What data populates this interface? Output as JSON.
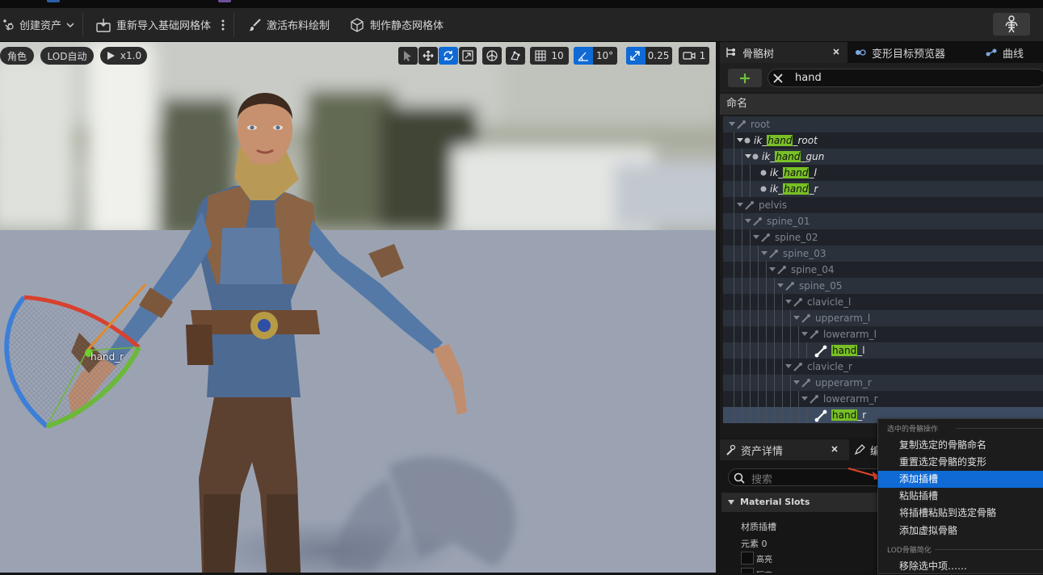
{
  "toolbar": {
    "create_asset": "创建资产",
    "reimport_base_mesh": "重新导入基础网格体",
    "activate_cloth_paint": "激活布料绘制",
    "make_static_mesh": "制作静态网格体"
  },
  "viewport": {
    "character_label": "角色",
    "lod_label": "LOD自动",
    "play_speed": "x1.0",
    "grid_size": "10",
    "rotation_snap": "10°",
    "scale_snap": "0.25",
    "camera_speed": "1",
    "bone_label": "hand_r"
  },
  "skeleton_panel": {
    "tabs": [
      {
        "label": "骨骼树",
        "icon": "bone-tree-icon"
      },
      {
        "label": "变形目标预览器",
        "icon": "morph-target-icon"
      },
      {
        "label": "曲线",
        "icon": "curve-icon"
      }
    ],
    "search_value": "hand",
    "column_header": "命名",
    "tree": [
      {
        "pre": "",
        "match": "",
        "post": "root",
        "depth": 0,
        "kind": "bone",
        "italic": false,
        "dim": true
      },
      {
        "pre": "ik_",
        "match": "hand",
        "post": "_root",
        "depth": 1,
        "kind": "virtual",
        "italic": true,
        "dim": false
      },
      {
        "pre": "ik_",
        "match": "hand",
        "post": "_gun",
        "depth": 2,
        "kind": "virtual",
        "italic": true,
        "dim": false
      },
      {
        "pre": "ik_",
        "match": "hand",
        "post": "_l",
        "depth": 3,
        "kind": "virtual",
        "italic": true,
        "dim": false
      },
      {
        "pre": "ik_",
        "match": "hand",
        "post": "_r",
        "depth": 3,
        "kind": "virtual",
        "italic": true,
        "dim": false
      },
      {
        "pre": "",
        "match": "",
        "post": "pelvis",
        "depth": 1,
        "kind": "bone",
        "italic": false,
        "dim": true
      },
      {
        "pre": "",
        "match": "",
        "post": "spine_01",
        "depth": 2,
        "kind": "bone",
        "italic": false,
        "dim": true
      },
      {
        "pre": "",
        "match": "",
        "post": "spine_02",
        "depth": 3,
        "kind": "bone",
        "italic": false,
        "dim": true
      },
      {
        "pre": "",
        "match": "",
        "post": "spine_03",
        "depth": 4,
        "kind": "bone",
        "italic": false,
        "dim": true
      },
      {
        "pre": "",
        "match": "",
        "post": "spine_04",
        "depth": 5,
        "kind": "bone",
        "italic": false,
        "dim": true
      },
      {
        "pre": "",
        "match": "",
        "post": "spine_05",
        "depth": 6,
        "kind": "bone",
        "italic": false,
        "dim": true
      },
      {
        "pre": "",
        "match": "",
        "post": "clavicle_l",
        "depth": 7,
        "kind": "bone",
        "italic": false,
        "dim": true
      },
      {
        "pre": "",
        "match": "",
        "post": "upperarm_l",
        "depth": 8,
        "kind": "bone",
        "italic": false,
        "dim": true
      },
      {
        "pre": "",
        "match": "",
        "post": "lowerarm_l",
        "depth": 9,
        "kind": "bone",
        "italic": false,
        "dim": true
      },
      {
        "pre": "",
        "match": "hand",
        "post": "_l",
        "depth": 10,
        "kind": "bone-bright",
        "italic": false,
        "dim": false
      },
      {
        "pre": "",
        "match": "",
        "post": "clavicle_r",
        "depth": 7,
        "kind": "bone",
        "italic": false,
        "dim": true
      },
      {
        "pre": "",
        "match": "",
        "post": "upperarm_r",
        "depth": 8,
        "kind": "bone",
        "italic": false,
        "dim": true
      },
      {
        "pre": "",
        "match": "",
        "post": "lowerarm_r",
        "depth": 9,
        "kind": "bone",
        "italic": false,
        "dim": true
      },
      {
        "pre": "",
        "match": "hand",
        "post": "_r",
        "depth": 10,
        "kind": "bone-bright",
        "italic": false,
        "dim": false,
        "selected": true
      }
    ]
  },
  "details_panel": {
    "tab_label": "资产详情",
    "tab2_label": "编",
    "search_placeholder": "搜索",
    "section_label": "Material Slots",
    "slots_label": "材质插槽",
    "element_label": "元素 0",
    "highlight_label": "高亮",
    "isolate_label": "隔离"
  },
  "context_menu": {
    "header_bone_actions": "选中的骨骼操作",
    "items": [
      {
        "label": "复制选定的骨骼命名",
        "selected": false
      },
      {
        "label": "重置选定骨骼的变形",
        "selected": false
      },
      {
        "label": "添加插槽",
        "selected": true
      },
      {
        "label": "粘贴插槽",
        "selected": false
      },
      {
        "label": "将插槽粘贴到选定骨骼",
        "selected": false
      },
      {
        "label": "添加虚拟骨骼",
        "selected": false
      }
    ],
    "header_lod": "LOD骨骼简化",
    "remove_item": "移除选中项……"
  },
  "colors": {
    "accent_blue": "#0f6ad6",
    "search_highlight": "#78c025",
    "annotation_arrow": "#e0442a",
    "gizmo_red": "#d9402e",
    "gizmo_green": "#6cb83a",
    "gizmo_blue": "#3c7fd8"
  }
}
